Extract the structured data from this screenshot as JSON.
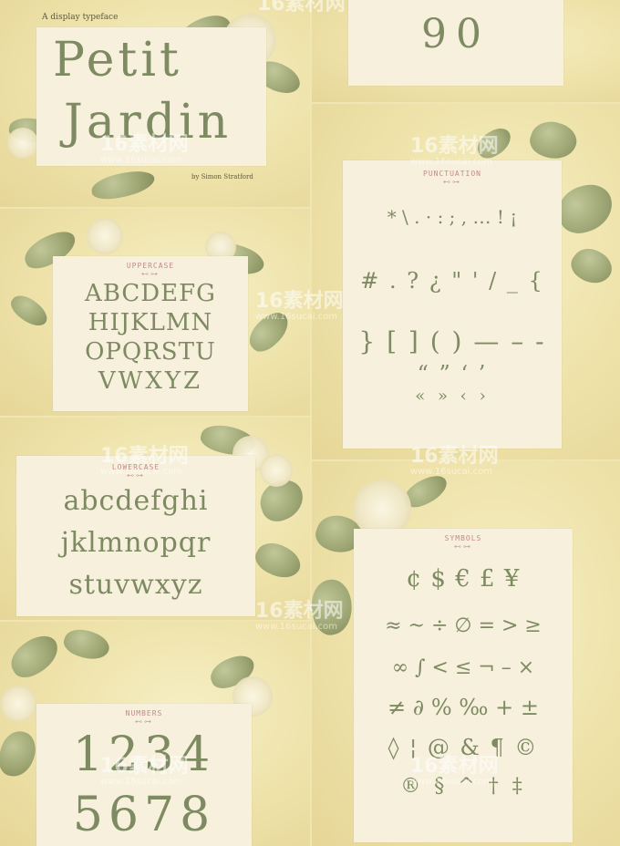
{
  "title_card": {
    "tagline": "A display typeface",
    "title_line1": "Petit",
    "title_line2": "Jardin",
    "byline": "by Simon Stratford"
  },
  "sections": {
    "numbers_preview": {
      "glyphs": "90"
    },
    "punctuation": {
      "label": "PUNCTUATION",
      "rows": [
        "* \\ . · : ; , … ! ¡",
        "# . ? ¿ \" ' / _ {",
        "} [ ] ( ) — – -",
        "“ ” ‘ ’",
        "« » ‹ ›"
      ]
    },
    "uppercase": {
      "label": "UPPERCASE",
      "rows": [
        "ABCDEFG",
        "HIJKLMN",
        "OPQRSTU",
        "VWXYZ"
      ]
    },
    "lowercase": {
      "label": "LOWERCASE",
      "rows": [
        "abcdefghi",
        "jklmnopqr",
        "stuvwxyz"
      ]
    },
    "symbols": {
      "label": "SYMBOLS",
      "rows": [
        "¢ $ € £ ¥",
        "≈ ~ ÷ ∅ = > ≥",
        "∞ ∫ < ≤ ¬ – ×",
        "≠ ∂ % ‰ + ±",
        "◊ ¦ @ & ¶ ©",
        "® § ^ † ‡"
      ]
    },
    "numbers": {
      "label": "NUMBERS",
      "rows": [
        "1234",
        "5678"
      ]
    }
  },
  "watermark": {
    "brand": "16素材网",
    "url": "www.16sucai.com"
  },
  "colors": {
    "background": "#efe6b4",
    "card": "#f6f0dc",
    "glyph": "#7e8a62",
    "label": "#c58a8a"
  }
}
